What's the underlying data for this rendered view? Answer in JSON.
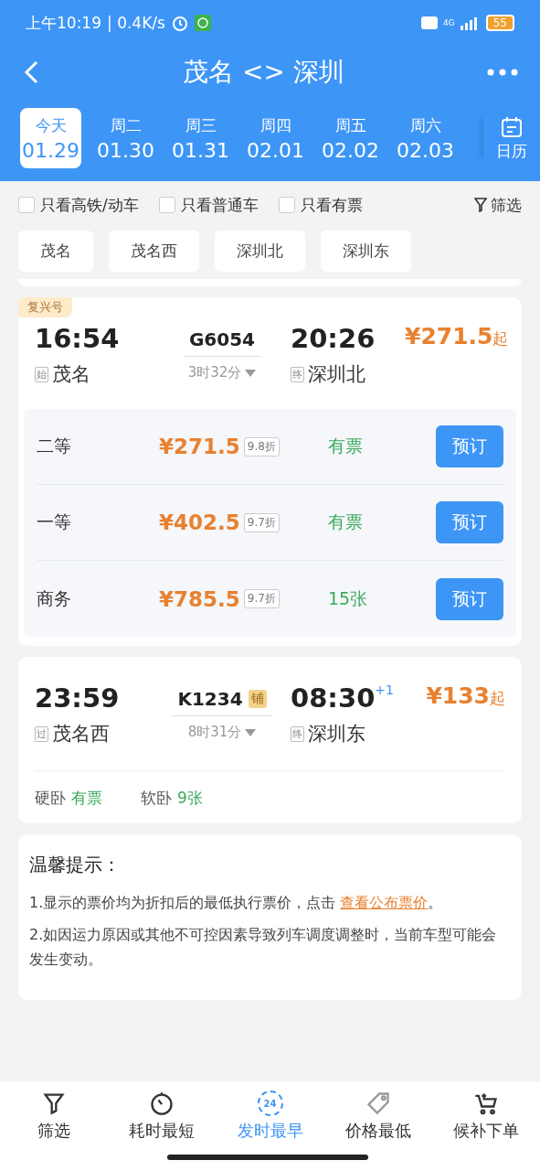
{
  "status_bar": {
    "time": "上午10:19",
    "speed": "| 0.4K/s",
    "network": "4G",
    "battery": "55"
  },
  "header": {
    "title": "茂名 <> 深圳"
  },
  "dates": [
    {
      "weekday": "今天",
      "date": "01.29",
      "selected": true
    },
    {
      "weekday": "周二",
      "date": "01.30",
      "selected": false
    },
    {
      "weekday": "周三",
      "date": "01.31",
      "selected": false
    },
    {
      "weekday": "周四",
      "date": "02.01",
      "selected": false
    },
    {
      "weekday": "周五",
      "date": "02.02",
      "selected": false
    },
    {
      "weekday": "周六",
      "date": "02.03",
      "selected": false
    }
  ],
  "calendar_label": "日历",
  "filters": [
    {
      "label": "只看高铁/动车",
      "checked": false
    },
    {
      "label": "只看普通车",
      "checked": false
    },
    {
      "label": "只看有票",
      "checked": false
    }
  ],
  "filter_button": "筛选",
  "stations": [
    "茂名",
    "茂名西",
    "深圳北",
    "深圳东"
  ],
  "trains": [
    {
      "kind": "expanded",
      "tag": "复兴号",
      "depart": "16:54",
      "from_mark": "始",
      "from": "茂名",
      "number": "G6054",
      "duration": "3时32分",
      "arrive": "20:26",
      "to_mark": "终",
      "to": "深圳北",
      "price": "¥271.5",
      "price_suffix": "起",
      "seats": [
        {
          "name": "二等",
          "price": "¥271.5",
          "discount": "9.8折",
          "availability": "有票",
          "button": "预订"
        },
        {
          "name": "一等",
          "price": "¥402.5",
          "discount": "9.7折",
          "availability": "有票",
          "button": "预订"
        },
        {
          "name": "商务",
          "price": "¥785.5",
          "discount": "9.7折",
          "availability": "15张",
          "button": "预订"
        }
      ]
    },
    {
      "kind": "collapsed",
      "depart": "23:59",
      "from_mark": "过",
      "from": "茂名西",
      "number": "K1234",
      "badge": "铺",
      "duration": "8时31分",
      "arrive": "08:30",
      "day_offset": "+1",
      "to_mark": "终",
      "to": "深圳东",
      "price": "¥133",
      "price_suffix": "起",
      "seats": [
        {
          "name": "硬卧",
          "availability": "有票"
        },
        {
          "name": "软卧",
          "availability": "9张"
        }
      ]
    }
  ],
  "notice": {
    "title": "温馨提示：",
    "lines": [
      {
        "text": "1.显示的票价均为折扣后的最低执行票价，点击 ",
        "link": "查看公布票价",
        "after": "。"
      },
      {
        "text": "2.如因运力原因或其他不可控因素导致列车调度调整时，当前车型可能会发生变动。"
      }
    ]
  },
  "bottom_nav": [
    {
      "kind": "filter",
      "label": "筛选",
      "selected": false
    },
    {
      "kind": "timer",
      "label": "耗时最短",
      "selected": false
    },
    {
      "kind": "clock24",
      "label": "发时最早",
      "icon_text": "24",
      "selected": true
    },
    {
      "kind": "tag",
      "label": "价格最低",
      "selected": false
    },
    {
      "kind": "cart",
      "label": "候补下单",
      "selected": false
    }
  ]
}
